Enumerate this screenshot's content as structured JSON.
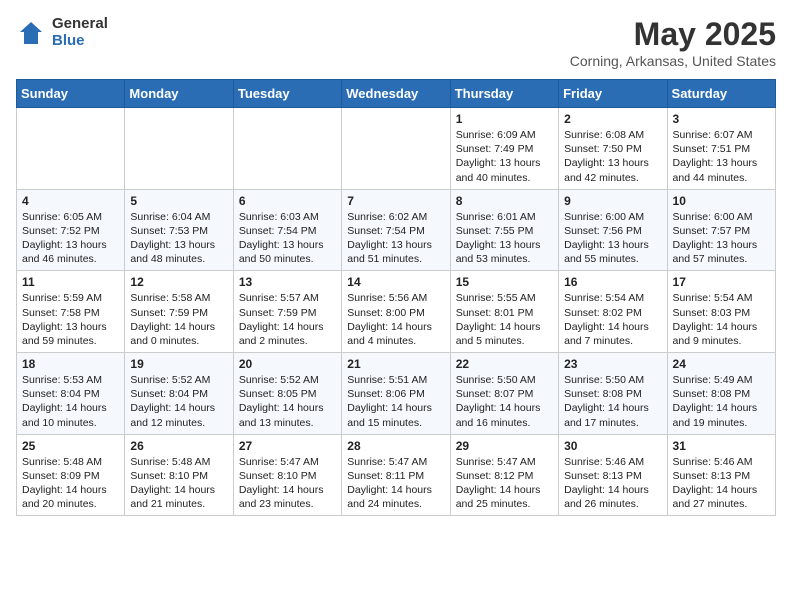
{
  "logo": {
    "general": "General",
    "blue": "Blue"
  },
  "title": "May 2025",
  "subtitle": "Corning, Arkansas, United States",
  "weekdays": [
    "Sunday",
    "Monday",
    "Tuesday",
    "Wednesday",
    "Thursday",
    "Friday",
    "Saturday"
  ],
  "weeks": [
    [
      {
        "day": "",
        "content": ""
      },
      {
        "day": "",
        "content": ""
      },
      {
        "day": "",
        "content": ""
      },
      {
        "day": "",
        "content": ""
      },
      {
        "day": "1",
        "content": "Sunrise: 6:09 AM\nSunset: 7:49 PM\nDaylight: 13 hours\nand 40 minutes."
      },
      {
        "day": "2",
        "content": "Sunrise: 6:08 AM\nSunset: 7:50 PM\nDaylight: 13 hours\nand 42 minutes."
      },
      {
        "day": "3",
        "content": "Sunrise: 6:07 AM\nSunset: 7:51 PM\nDaylight: 13 hours\nand 44 minutes."
      }
    ],
    [
      {
        "day": "4",
        "content": "Sunrise: 6:05 AM\nSunset: 7:52 PM\nDaylight: 13 hours\nand 46 minutes."
      },
      {
        "day": "5",
        "content": "Sunrise: 6:04 AM\nSunset: 7:53 PM\nDaylight: 13 hours\nand 48 minutes."
      },
      {
        "day": "6",
        "content": "Sunrise: 6:03 AM\nSunset: 7:54 PM\nDaylight: 13 hours\nand 50 minutes."
      },
      {
        "day": "7",
        "content": "Sunrise: 6:02 AM\nSunset: 7:54 PM\nDaylight: 13 hours\nand 51 minutes."
      },
      {
        "day": "8",
        "content": "Sunrise: 6:01 AM\nSunset: 7:55 PM\nDaylight: 13 hours\nand 53 minutes."
      },
      {
        "day": "9",
        "content": "Sunrise: 6:00 AM\nSunset: 7:56 PM\nDaylight: 13 hours\nand 55 minutes."
      },
      {
        "day": "10",
        "content": "Sunrise: 6:00 AM\nSunset: 7:57 PM\nDaylight: 13 hours\nand 57 minutes."
      }
    ],
    [
      {
        "day": "11",
        "content": "Sunrise: 5:59 AM\nSunset: 7:58 PM\nDaylight: 13 hours\nand 59 minutes."
      },
      {
        "day": "12",
        "content": "Sunrise: 5:58 AM\nSunset: 7:59 PM\nDaylight: 14 hours\nand 0 minutes."
      },
      {
        "day": "13",
        "content": "Sunrise: 5:57 AM\nSunset: 7:59 PM\nDaylight: 14 hours\nand 2 minutes."
      },
      {
        "day": "14",
        "content": "Sunrise: 5:56 AM\nSunset: 8:00 PM\nDaylight: 14 hours\nand 4 minutes."
      },
      {
        "day": "15",
        "content": "Sunrise: 5:55 AM\nSunset: 8:01 PM\nDaylight: 14 hours\nand 5 minutes."
      },
      {
        "day": "16",
        "content": "Sunrise: 5:54 AM\nSunset: 8:02 PM\nDaylight: 14 hours\nand 7 minutes."
      },
      {
        "day": "17",
        "content": "Sunrise: 5:54 AM\nSunset: 8:03 PM\nDaylight: 14 hours\nand 9 minutes."
      }
    ],
    [
      {
        "day": "18",
        "content": "Sunrise: 5:53 AM\nSunset: 8:04 PM\nDaylight: 14 hours\nand 10 minutes."
      },
      {
        "day": "19",
        "content": "Sunrise: 5:52 AM\nSunset: 8:04 PM\nDaylight: 14 hours\nand 12 minutes."
      },
      {
        "day": "20",
        "content": "Sunrise: 5:52 AM\nSunset: 8:05 PM\nDaylight: 14 hours\nand 13 minutes."
      },
      {
        "day": "21",
        "content": "Sunrise: 5:51 AM\nSunset: 8:06 PM\nDaylight: 14 hours\nand 15 minutes."
      },
      {
        "day": "22",
        "content": "Sunrise: 5:50 AM\nSunset: 8:07 PM\nDaylight: 14 hours\nand 16 minutes."
      },
      {
        "day": "23",
        "content": "Sunrise: 5:50 AM\nSunset: 8:08 PM\nDaylight: 14 hours\nand 17 minutes."
      },
      {
        "day": "24",
        "content": "Sunrise: 5:49 AM\nSunset: 8:08 PM\nDaylight: 14 hours\nand 19 minutes."
      }
    ],
    [
      {
        "day": "25",
        "content": "Sunrise: 5:48 AM\nSunset: 8:09 PM\nDaylight: 14 hours\nand 20 minutes."
      },
      {
        "day": "26",
        "content": "Sunrise: 5:48 AM\nSunset: 8:10 PM\nDaylight: 14 hours\nand 21 minutes."
      },
      {
        "day": "27",
        "content": "Sunrise: 5:47 AM\nSunset: 8:10 PM\nDaylight: 14 hours\nand 23 minutes."
      },
      {
        "day": "28",
        "content": "Sunrise: 5:47 AM\nSunset: 8:11 PM\nDaylight: 14 hours\nand 24 minutes."
      },
      {
        "day": "29",
        "content": "Sunrise: 5:47 AM\nSunset: 8:12 PM\nDaylight: 14 hours\nand 25 minutes."
      },
      {
        "day": "30",
        "content": "Sunrise: 5:46 AM\nSunset: 8:13 PM\nDaylight: 14 hours\nand 26 minutes."
      },
      {
        "day": "31",
        "content": "Sunrise: 5:46 AM\nSunset: 8:13 PM\nDaylight: 14 hours\nand 27 minutes."
      }
    ]
  ]
}
